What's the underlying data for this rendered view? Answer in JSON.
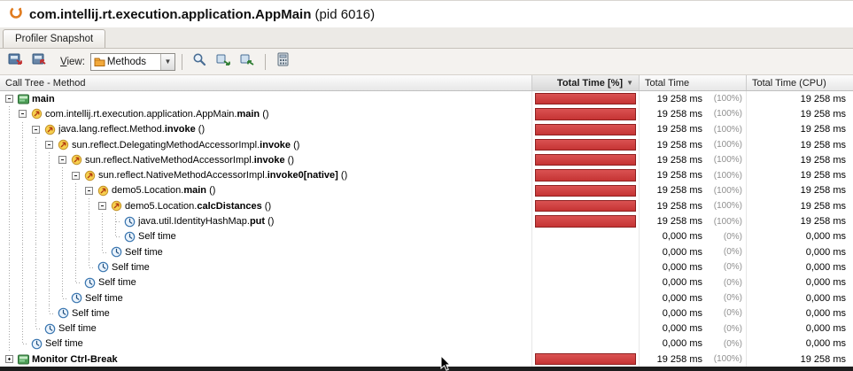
{
  "window": {
    "title_main": "com.intellij.rt.execution.application.AppMain",
    "title_suffix": " (pid 6016)"
  },
  "tabs": [
    {
      "label": "Profiler Snapshot"
    }
  ],
  "toolbar": {
    "view_mnemonic": "V",
    "view_label_rest": "iew:",
    "view_value": "Methods",
    "combo_arrow": "▼"
  },
  "table": {
    "columns": [
      "Call Tree - Method",
      "Total Time [%]",
      "Total Time",
      "Total Time (CPU)"
    ],
    "sort_indicator": "▼",
    "bar_color": "#c53434",
    "rows": [
      {
        "depth": 0,
        "exp": "minus",
        "icon": "thread",
        "pkg": "",
        "name": "main",
        "args": "",
        "bold": true,
        "pct": 100,
        "time": "19 258 ms",
        "time_pct": "(100%)",
        "cpu": "19 258 ms"
      },
      {
        "depth": 1,
        "exp": "minus",
        "icon": "method",
        "pkg": "com.intellij.rt.execution.application.AppMain.",
        "name": "main",
        "args": " ()",
        "bold": true,
        "pct": 100,
        "time": "19 258 ms",
        "time_pct": "(100%)",
        "cpu": "19 258 ms"
      },
      {
        "depth": 2,
        "exp": "minus",
        "icon": "method",
        "pkg": "java.lang.reflect.Method.",
        "name": "invoke",
        "args": " ()",
        "bold": true,
        "pct": 100,
        "time": "19 258 ms",
        "time_pct": "(100%)",
        "cpu": "19 258 ms"
      },
      {
        "depth": 3,
        "exp": "minus",
        "icon": "method",
        "pkg": "sun.reflect.DelegatingMethodAccessorImpl.",
        "name": "invoke",
        "args": " ()",
        "bold": true,
        "pct": 100,
        "time": "19 258 ms",
        "time_pct": "(100%)",
        "cpu": "19 258 ms"
      },
      {
        "depth": 4,
        "exp": "minus",
        "icon": "method",
        "pkg": "sun.reflect.NativeMethodAccessorImpl.",
        "name": "invoke",
        "args": " ()",
        "bold": true,
        "pct": 100,
        "time": "19 258 ms",
        "time_pct": "(100%)",
        "cpu": "19 258 ms"
      },
      {
        "depth": 5,
        "exp": "minus",
        "icon": "method",
        "pkg": "sun.reflect.NativeMethodAccessorImpl.",
        "name": "invoke0[native]",
        "args": " ()",
        "bold": true,
        "pct": 100,
        "time": "19 258 ms",
        "time_pct": "(100%)",
        "cpu": "19 258 ms"
      },
      {
        "depth": 6,
        "exp": "minus",
        "icon": "method",
        "pkg": "demo5.Location.",
        "name": "main",
        "args": " ()",
        "bold": true,
        "pct": 100,
        "time": "19 258 ms",
        "time_pct": "(100%)",
        "cpu": "19 258 ms"
      },
      {
        "depth": 7,
        "exp": "minus",
        "icon": "method",
        "pkg": "demo5.Location.",
        "name": "calcDistances",
        "args": " ()",
        "bold": true,
        "pct": 100,
        "time": "19 258 ms",
        "time_pct": "(100%)",
        "cpu": "19 258 ms"
      },
      {
        "depth": 8,
        "conn": "mid",
        "icon": "clock",
        "pkg": "java.util.IdentityHashMap.",
        "name": "put",
        "args": " ()",
        "bold": true,
        "pct": 100,
        "time": "19 258 ms",
        "time_pct": "(100%)",
        "cpu": "19 258 ms"
      },
      {
        "depth": 8,
        "conn": "last",
        "icon": "clock",
        "pkg": "",
        "name": "Self time",
        "args": "",
        "bold": false,
        "pct": 0,
        "time": "0,000 ms",
        "time_pct": "(0%)",
        "cpu": "0,000 ms"
      },
      {
        "depth": 7,
        "conn": "last",
        "icon": "clock",
        "pkg": "",
        "name": "Self time",
        "args": "",
        "bold": false,
        "pct": 0,
        "time": "0,000 ms",
        "time_pct": "(0%)",
        "cpu": "0,000 ms"
      },
      {
        "depth": 6,
        "conn": "last",
        "icon": "clock",
        "pkg": "",
        "name": "Self time",
        "args": "",
        "bold": false,
        "pct": 0,
        "time": "0,000 ms",
        "time_pct": "(0%)",
        "cpu": "0,000 ms"
      },
      {
        "depth": 5,
        "conn": "last",
        "icon": "clock",
        "pkg": "",
        "name": "Self time",
        "args": "",
        "bold": false,
        "pct": 0,
        "time": "0,000 ms",
        "time_pct": "(0%)",
        "cpu": "0,000 ms"
      },
      {
        "depth": 4,
        "conn": "last",
        "icon": "clock",
        "pkg": "",
        "name": "Self time",
        "args": "",
        "bold": false,
        "pct": 0,
        "time": "0,000 ms",
        "time_pct": "(0%)",
        "cpu": "0,000 ms"
      },
      {
        "depth": 3,
        "conn": "last",
        "icon": "clock",
        "pkg": "",
        "name": "Self time",
        "args": "",
        "bold": false,
        "pct": 0,
        "time": "0,000 ms",
        "time_pct": "(0%)",
        "cpu": "0,000 ms"
      },
      {
        "depth": 2,
        "conn": "last",
        "icon": "clock",
        "pkg": "",
        "name": "Self time",
        "args": "",
        "bold": false,
        "pct": 0,
        "time": "0,000 ms",
        "time_pct": "(0%)",
        "cpu": "0,000 ms"
      },
      {
        "depth": 1,
        "conn": "last",
        "icon": "clock",
        "pkg": "",
        "name": "Self time",
        "args": "",
        "bold": false,
        "pct": 0,
        "time": "0,000 ms",
        "time_pct": "(0%)",
        "cpu": "0,000 ms"
      },
      {
        "depth": 0,
        "exp": "plus",
        "icon": "thread",
        "pkg": "",
        "name": "Monitor Ctrl-Break",
        "args": "",
        "bold": true,
        "pct": 100,
        "time": "19 258 ms",
        "time_pct": "(100%)",
        "cpu": "19 258 ms"
      }
    ]
  }
}
